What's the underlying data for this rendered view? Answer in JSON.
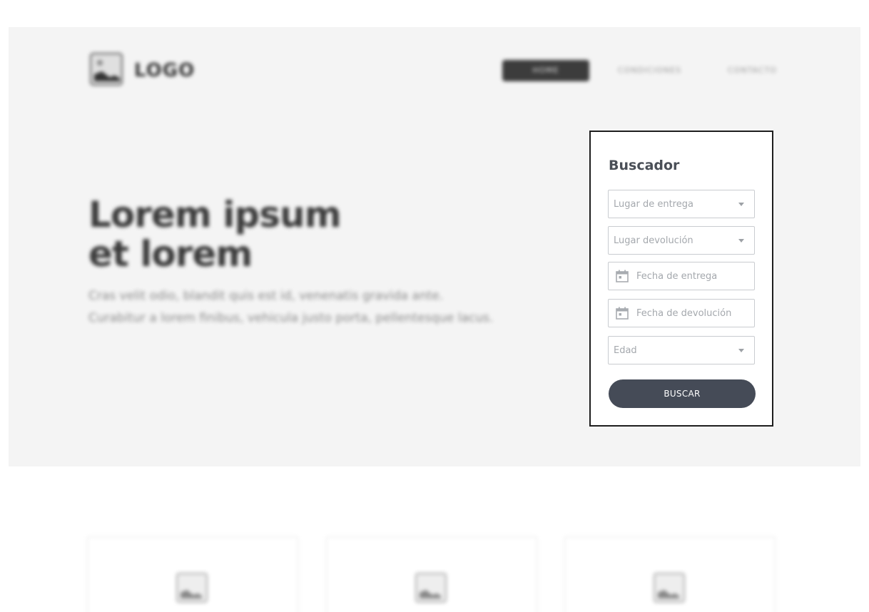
{
  "header": {
    "logo_text": "LOGO",
    "nav": {
      "primary_label": "HOME",
      "link_1": "CONDICIONES",
      "link_2": "CONTACTO"
    }
  },
  "hero": {
    "title_line_1": "Lorem ipsum",
    "title_line_2": "et lorem",
    "subtitle_line_1": "Cras velit odio, blandit quis est id, venenatis gravida ante.",
    "subtitle_line_2": "Curabitur a lorem finibus, vehicula justo porta, pellentesque lacus."
  },
  "search": {
    "title": "Buscador",
    "fields": {
      "pickup_place": "Lugar de entrega",
      "return_place": "Lugar devolución",
      "pickup_date": "Fecha de entrega",
      "return_date": "Fecha de devolución",
      "age": "Edad"
    },
    "submit_label": "BUSCAR"
  },
  "icons": {
    "dropdown": "chevron-down-icon",
    "date": "calendar-icon",
    "logo": "image-placeholder-icon"
  },
  "colors": {
    "hero_bg": "#f4f4f4",
    "panel_border": "#1e1e1e",
    "button_bg": "#454b57",
    "title_color": "#4a4f57",
    "placeholder_color": "#a4a8ad"
  }
}
